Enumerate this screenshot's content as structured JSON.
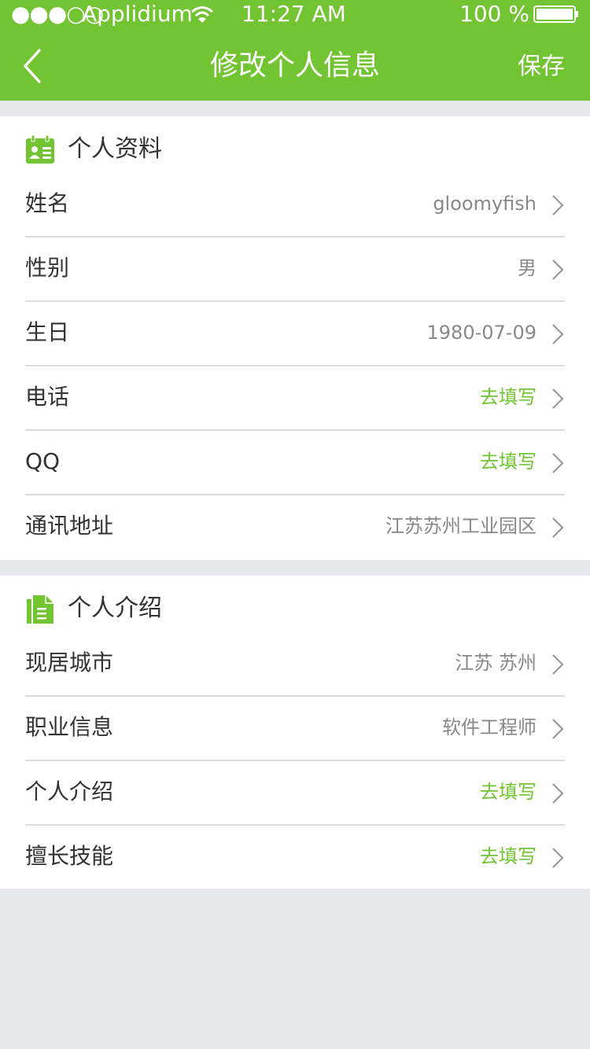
{
  "status_bar": {
    "signal": "●●●○○",
    "carrier": "Applidium",
    "time": "11:27 AM",
    "battery": "100 %"
  },
  "nav": {
    "back_icon": "chevron-left-icon",
    "title": "修改个人信息",
    "save_label": "保存"
  },
  "colors": {
    "brand_green": "#72c432",
    "placeholder_green": "#72c432",
    "background": "#e6e7ea"
  },
  "profile": {
    "title": "个人资料",
    "icon": "contact-card-icon",
    "rows": [
      {
        "label": "姓名",
        "value": "gloomyfish",
        "placeholder": false
      },
      {
        "label": "性别",
        "value": "男",
        "placeholder": false
      },
      {
        "label": "生日",
        "value": "1980-07-09",
        "placeholder": false
      },
      {
        "label": "电话",
        "value": "去填写",
        "placeholder": true
      },
      {
        "label": "QQ",
        "value": "去填写",
        "placeholder": true
      },
      {
        "label": "通讯地址",
        "value": "江苏苏州工业园区",
        "placeholder": false
      }
    ]
  },
  "intro": {
    "title": "个人介绍",
    "icon": "document-icon",
    "rows": [
      {
        "label": "现居城市",
        "value": "江苏 苏州",
        "placeholder": false
      },
      {
        "label": "职业信息",
        "value": "软件工程师",
        "placeholder": false
      },
      {
        "label": "个人介绍",
        "value": "去填写",
        "placeholder": true
      },
      {
        "label": "擅长技能",
        "value": "去填写",
        "placeholder": true
      }
    ]
  }
}
